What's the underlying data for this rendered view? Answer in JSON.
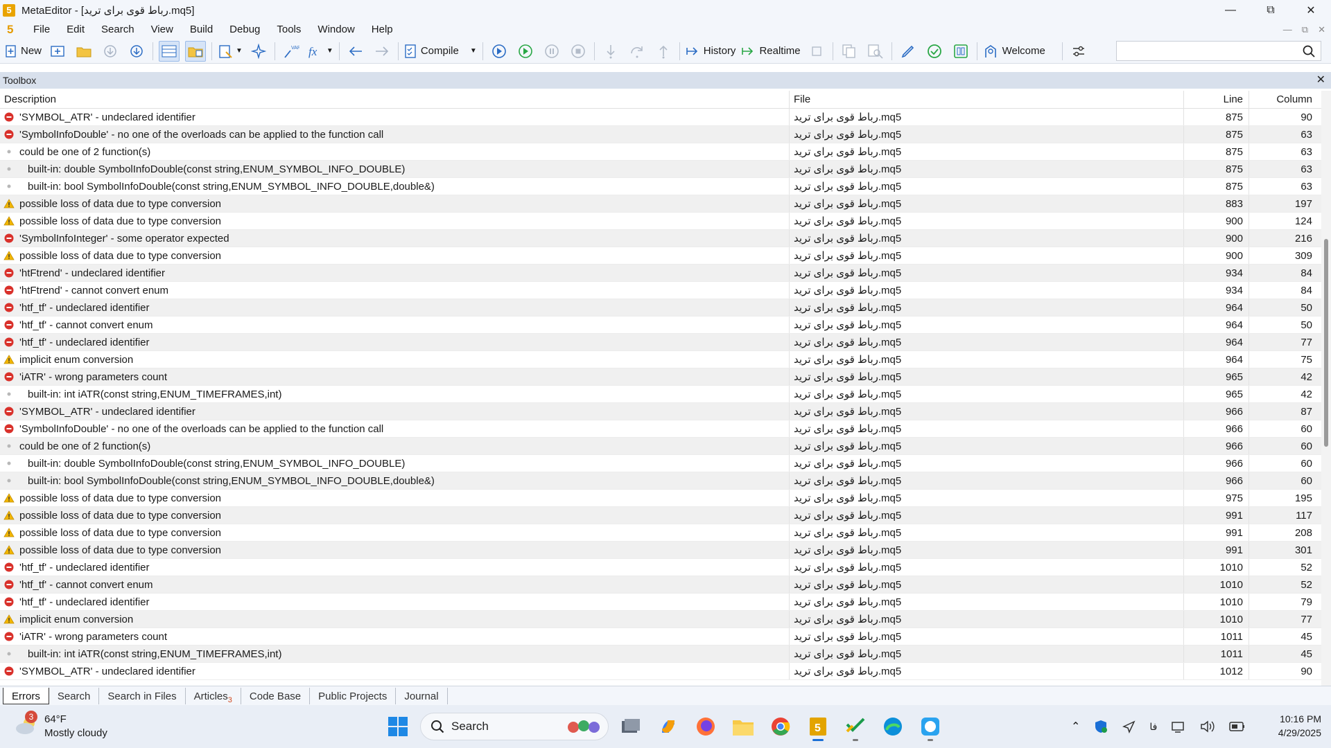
{
  "window": {
    "title": "MetaEditor - [رباط قوی برای ترید.mq5]",
    "logo_text": "5"
  },
  "menu": [
    "File",
    "Edit",
    "Search",
    "View",
    "Build",
    "Debug",
    "Tools",
    "Window",
    "Help"
  ],
  "toolbar": {
    "new_label": "New",
    "compile_label": "Compile",
    "history_label": "History",
    "realtime_label": "Realtime",
    "welcome_label": "Welcome",
    "search_placeholder": ""
  },
  "toolbox": {
    "title": "Toolbox",
    "columns": {
      "description": "Description",
      "file": "File",
      "line": "Line",
      "column": "Column"
    },
    "rows": [
      {
        "type": "error",
        "indent": false,
        "description": "'SYMBOL_ATR' - undeclared identifier",
        "file": "رباط قوی برای ترید.mq5",
        "line": "875",
        "column": "90"
      },
      {
        "type": "error",
        "indent": false,
        "description": "'SymbolInfoDouble' - no one of the overloads can be applied to the function call",
        "file": "رباط قوی برای ترید.mq5",
        "line": "875",
        "column": "63"
      },
      {
        "type": "info",
        "indent": false,
        "description": "could be one of 2 function(s)",
        "file": "رباط قوی برای ترید.mq5",
        "line": "875",
        "column": "63"
      },
      {
        "type": "info",
        "indent": true,
        "description": "built-in: double SymbolInfoDouble(const string,ENUM_SYMBOL_INFO_DOUBLE)",
        "file": "رباط قوی برای ترید.mq5",
        "line": "875",
        "column": "63"
      },
      {
        "type": "info",
        "indent": true,
        "description": "built-in: bool SymbolInfoDouble(const string,ENUM_SYMBOL_INFO_DOUBLE,double&)",
        "file": "رباط قوی برای ترید.mq5",
        "line": "875",
        "column": "63"
      },
      {
        "type": "warning",
        "indent": false,
        "description": "possible loss of data due to type conversion",
        "file": "رباط قوی برای ترید.mq5",
        "line": "883",
        "column": "197"
      },
      {
        "type": "warning",
        "indent": false,
        "description": "possible loss of data due to type conversion",
        "file": "رباط قوی برای ترید.mq5",
        "line": "900",
        "column": "124"
      },
      {
        "type": "error",
        "indent": false,
        "description": "'SymbolInfoInteger' - some operator expected",
        "file": "رباط قوی برای ترید.mq5",
        "line": "900",
        "column": "216"
      },
      {
        "type": "warning",
        "indent": false,
        "description": "possible loss of data due to type conversion",
        "file": "رباط قوی برای ترید.mq5",
        "line": "900",
        "column": "309"
      },
      {
        "type": "error",
        "indent": false,
        "description": "'htFtrend' - undeclared identifier",
        "file": "رباط قوی برای ترید.mq5",
        "line": "934",
        "column": "84"
      },
      {
        "type": "error",
        "indent": false,
        "description": "'htFtrend' - cannot convert enum",
        "file": "رباط قوی برای ترید.mq5",
        "line": "934",
        "column": "84"
      },
      {
        "type": "error",
        "indent": false,
        "description": "'htf_tf' - undeclared identifier",
        "file": "رباط قوی برای ترید.mq5",
        "line": "964",
        "column": "50"
      },
      {
        "type": "error",
        "indent": false,
        "description": "'htf_tf' - cannot convert enum",
        "file": "رباط قوی برای ترید.mq5",
        "line": "964",
        "column": "50"
      },
      {
        "type": "error",
        "indent": false,
        "description": "'htf_tf' - undeclared identifier",
        "file": "رباط قوی برای ترید.mq5",
        "line": "964",
        "column": "77"
      },
      {
        "type": "warning",
        "indent": false,
        "description": "implicit enum conversion",
        "file": "رباط قوی برای ترید.mq5",
        "line": "964",
        "column": "75"
      },
      {
        "type": "error",
        "indent": false,
        "description": "'iATR' - wrong parameters count",
        "file": "رباط قوی برای ترید.mq5",
        "line": "965",
        "column": "42"
      },
      {
        "type": "info",
        "indent": true,
        "description": "built-in: int iATR(const string,ENUM_TIMEFRAMES,int)",
        "file": "رباط قوی برای ترید.mq5",
        "line": "965",
        "column": "42"
      },
      {
        "type": "error",
        "indent": false,
        "description": "'SYMBOL_ATR' - undeclared identifier",
        "file": "رباط قوی برای ترید.mq5",
        "line": "966",
        "column": "87"
      },
      {
        "type": "error",
        "indent": false,
        "description": "'SymbolInfoDouble' - no one of the overloads can be applied to the function call",
        "file": "رباط قوی برای ترید.mq5",
        "line": "966",
        "column": "60"
      },
      {
        "type": "info",
        "indent": false,
        "description": "could be one of 2 function(s)",
        "file": "رباط قوی برای ترید.mq5",
        "line": "966",
        "column": "60"
      },
      {
        "type": "info",
        "indent": true,
        "description": "built-in: double SymbolInfoDouble(const string,ENUM_SYMBOL_INFO_DOUBLE)",
        "file": "رباط قوی برای ترید.mq5",
        "line": "966",
        "column": "60"
      },
      {
        "type": "info",
        "indent": true,
        "description": "built-in: bool SymbolInfoDouble(const string,ENUM_SYMBOL_INFO_DOUBLE,double&)",
        "file": "رباط قوی برای ترید.mq5",
        "line": "966",
        "column": "60"
      },
      {
        "type": "warning",
        "indent": false,
        "description": "possible loss of data due to type conversion",
        "file": "رباط قوی برای ترید.mq5",
        "line": "975",
        "column": "195"
      },
      {
        "type": "warning",
        "indent": false,
        "description": "possible loss of data due to type conversion",
        "file": "رباط قوی برای ترید.mq5",
        "line": "991",
        "column": "117"
      },
      {
        "type": "warning",
        "indent": false,
        "description": "possible loss of data due to type conversion",
        "file": "رباط قوی برای ترید.mq5",
        "line": "991",
        "column": "208"
      },
      {
        "type": "warning",
        "indent": false,
        "description": "possible loss of data due to type conversion",
        "file": "رباط قوی برای ترید.mq5",
        "line": "991",
        "column": "301"
      },
      {
        "type": "error",
        "indent": false,
        "description": "'htf_tf' - undeclared identifier",
        "file": "رباط قوی برای ترید.mq5",
        "line": "1010",
        "column": "52"
      },
      {
        "type": "error",
        "indent": false,
        "description": "'htf_tf' - cannot convert enum",
        "file": "رباط قوی برای ترید.mq5",
        "line": "1010",
        "column": "52"
      },
      {
        "type": "error",
        "indent": false,
        "description": "'htf_tf' - undeclared identifier",
        "file": "رباط قوی برای ترید.mq5",
        "line": "1010",
        "column": "79"
      },
      {
        "type": "warning",
        "indent": false,
        "description": "implicit enum conversion",
        "file": "رباط قوی برای ترید.mq5",
        "line": "1010",
        "column": "77"
      },
      {
        "type": "error",
        "indent": false,
        "description": "'iATR' - wrong parameters count",
        "file": "رباط قوی برای ترید.mq5",
        "line": "1011",
        "column": "45"
      },
      {
        "type": "info",
        "indent": true,
        "description": "built-in: int iATR(const string,ENUM_TIMEFRAMES,int)",
        "file": "رباط قوی برای ترید.mq5",
        "line": "1011",
        "column": "45"
      },
      {
        "type": "error",
        "indent": false,
        "description": "'SYMBOL_ATR' - undeclared identifier",
        "file": "رباط قوی برای ترید.mq5",
        "line": "1012",
        "column": "90"
      }
    ]
  },
  "bottom_tabs": [
    {
      "label": "Errors",
      "active": true,
      "badge": ""
    },
    {
      "label": "Search",
      "active": false,
      "badge": ""
    },
    {
      "label": "Search in Files",
      "active": false,
      "badge": ""
    },
    {
      "label": "Articles",
      "active": false,
      "badge": "3"
    },
    {
      "label": "Code Base",
      "active": false,
      "badge": ""
    },
    {
      "label": "Public Projects",
      "active": false,
      "badge": ""
    },
    {
      "label": "Journal",
      "active": false,
      "badge": ""
    }
  ],
  "taskbar": {
    "weather_badge": "3",
    "temperature": "64°F",
    "condition": "Mostly cloudy",
    "search_label": "Search",
    "language": "فا",
    "time": "10:16 PM",
    "date": "4/29/2025"
  },
  "colors": {
    "error": "#d9312b",
    "warning": "#f2b600",
    "info": "#b8b8b8",
    "accent": "#1a6fd6"
  }
}
